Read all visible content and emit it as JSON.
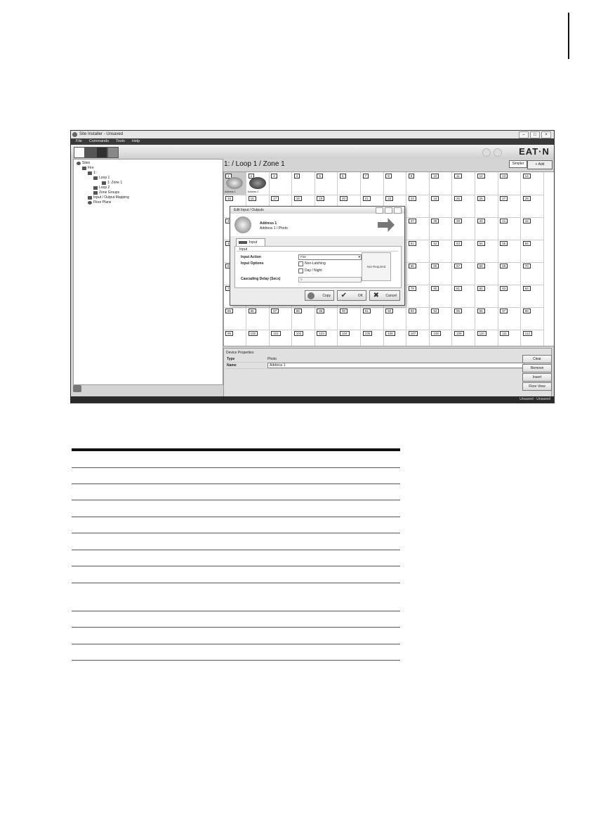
{
  "window": {
    "title": "Site Installer - Unsaved",
    "menus": [
      "File",
      "Commands",
      "Tools",
      "Help"
    ],
    "logo": "EAT·N",
    "status": "Unsaved - Unsaved"
  },
  "tree": {
    "items": [
      {
        "label": "Sites",
        "level": 0
      },
      {
        "label": "Fire",
        "level": 1
      },
      {
        "label": "1:",
        "level": 2
      },
      {
        "label": "Loop 1",
        "level": 3
      },
      {
        "label": "1: Zone 1",
        "level": 4
      },
      {
        "label": "Loop 2",
        "level": 3
      },
      {
        "label": "Zone Groups",
        "level": 3
      },
      {
        "label": "Input / Output Mapping",
        "level": 2
      },
      {
        "label": "Floor Plans",
        "level": 2
      }
    ]
  },
  "main": {
    "title": "1: / Loop 1 / Zone 1",
    "simpler": "Simpler",
    "add": "Add",
    "device_labels": [
      "Address 1",
      "Address 2"
    ]
  },
  "dialog": {
    "title": "Edit Input / Outputs",
    "device_name": "Address 1",
    "device_sub": "Address 1 / Photo",
    "tab": "Input",
    "group": "Input",
    "input_action_label": "Input Action",
    "input_action_value": "Fire",
    "input_options_label": "Input Options",
    "opt_nonlatching": "Non-Latching",
    "opt_daynight": "Day / Night",
    "cascading_label": "Cascading Delay (Secs)",
    "cascading_value": "0",
    "not_required": "Not Required",
    "copy": "Copy",
    "ok": "OK",
    "cancel": "Cancel"
  },
  "props": {
    "header": "Device Properties",
    "type_label": "Type",
    "type_value": "Photo",
    "name_label": "Name",
    "name_value": "Address 1"
  },
  "side": {
    "clear": "Clear",
    "remove": "Remove",
    "insert": "Insert",
    "floor_view": "Floor View"
  }
}
